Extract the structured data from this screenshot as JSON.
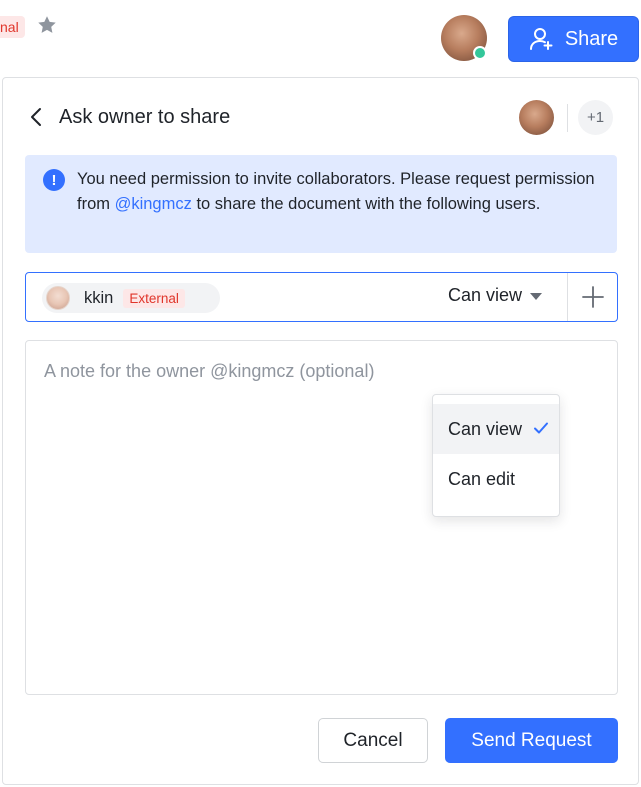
{
  "topbar": {
    "tag_label": "nal",
    "share_label": "Share"
  },
  "panel": {
    "title": "Ask owner to share",
    "collaborator_more": "+1",
    "notice": {
      "text_before": "You need permission to invite collaborators. Please request permission from ",
      "owner_mention": "@kingmcz",
      "text_after": " to share the document with the following users."
    },
    "invitee": {
      "name": "kkin",
      "tag": "External"
    },
    "permission": {
      "selected": "Can view",
      "options": [
        "Can view",
        "Can edit"
      ]
    },
    "note_placeholder": "A note for the owner @kingmcz (optional)",
    "cancel_label": "Cancel",
    "send_label": "Send Request"
  },
  "colors": {
    "accent": "#3370ff",
    "notice_bg": "#e1eaff",
    "external_tag": "#e0362b",
    "online": "#34c79a"
  }
}
